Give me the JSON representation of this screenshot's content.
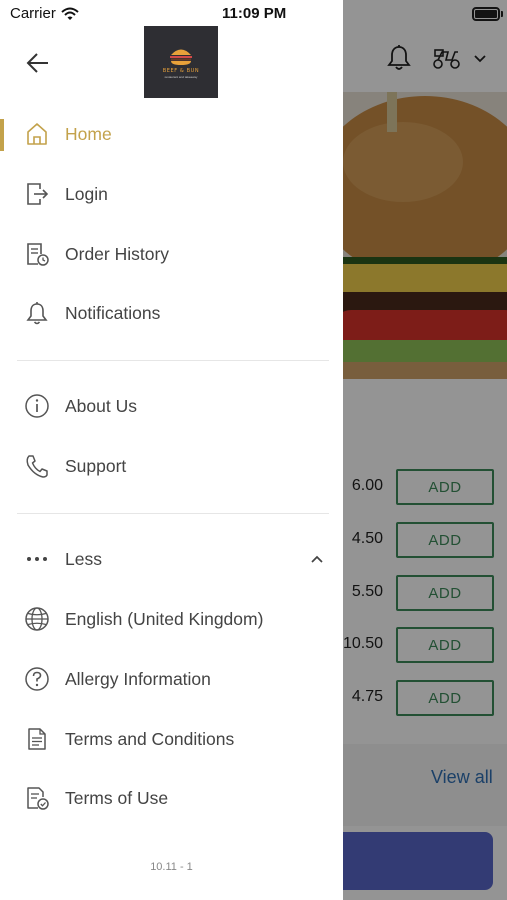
{
  "status_bar": {
    "carrier": "Carrier",
    "time": "11:09 PM"
  },
  "drawer": {
    "logo_alt": "BEEF & BUN",
    "logo_sub": "restaurant and takeaway",
    "menu_primary": [
      {
        "label": "Home",
        "icon": "home-icon",
        "active": true
      },
      {
        "label": "Login",
        "icon": "login-icon"
      },
      {
        "label": "Order History",
        "icon": "receipt-clock-icon"
      },
      {
        "label": "Notifications",
        "icon": "bell-icon"
      }
    ],
    "menu_secondary": [
      {
        "label": "About Us",
        "icon": "info-icon"
      },
      {
        "label": "Support",
        "icon": "phone-icon"
      }
    ],
    "menu_more": {
      "toggle_label": "Less",
      "items": [
        {
          "label": "English (United Kingdom)",
          "icon": "globe-icon"
        },
        {
          "label": "Allergy Information",
          "icon": "question-icon"
        },
        {
          "label": "Terms and Conditions",
          "icon": "document-icon"
        },
        {
          "label": "Terms of Use",
          "icon": "document-check-icon"
        }
      ]
    },
    "version": "10.11 - 1"
  },
  "background": {
    "prices": [
      "6.00",
      "4.50",
      "5.50",
      "10.50",
      "4.75"
    ],
    "add_label": "ADD",
    "view_all": "View all"
  },
  "colors": {
    "accent_gold": "#c3a24b",
    "add_green": "#3d8a5a",
    "link_blue": "#2f6fb3",
    "cta_blue": "#5866c8"
  }
}
